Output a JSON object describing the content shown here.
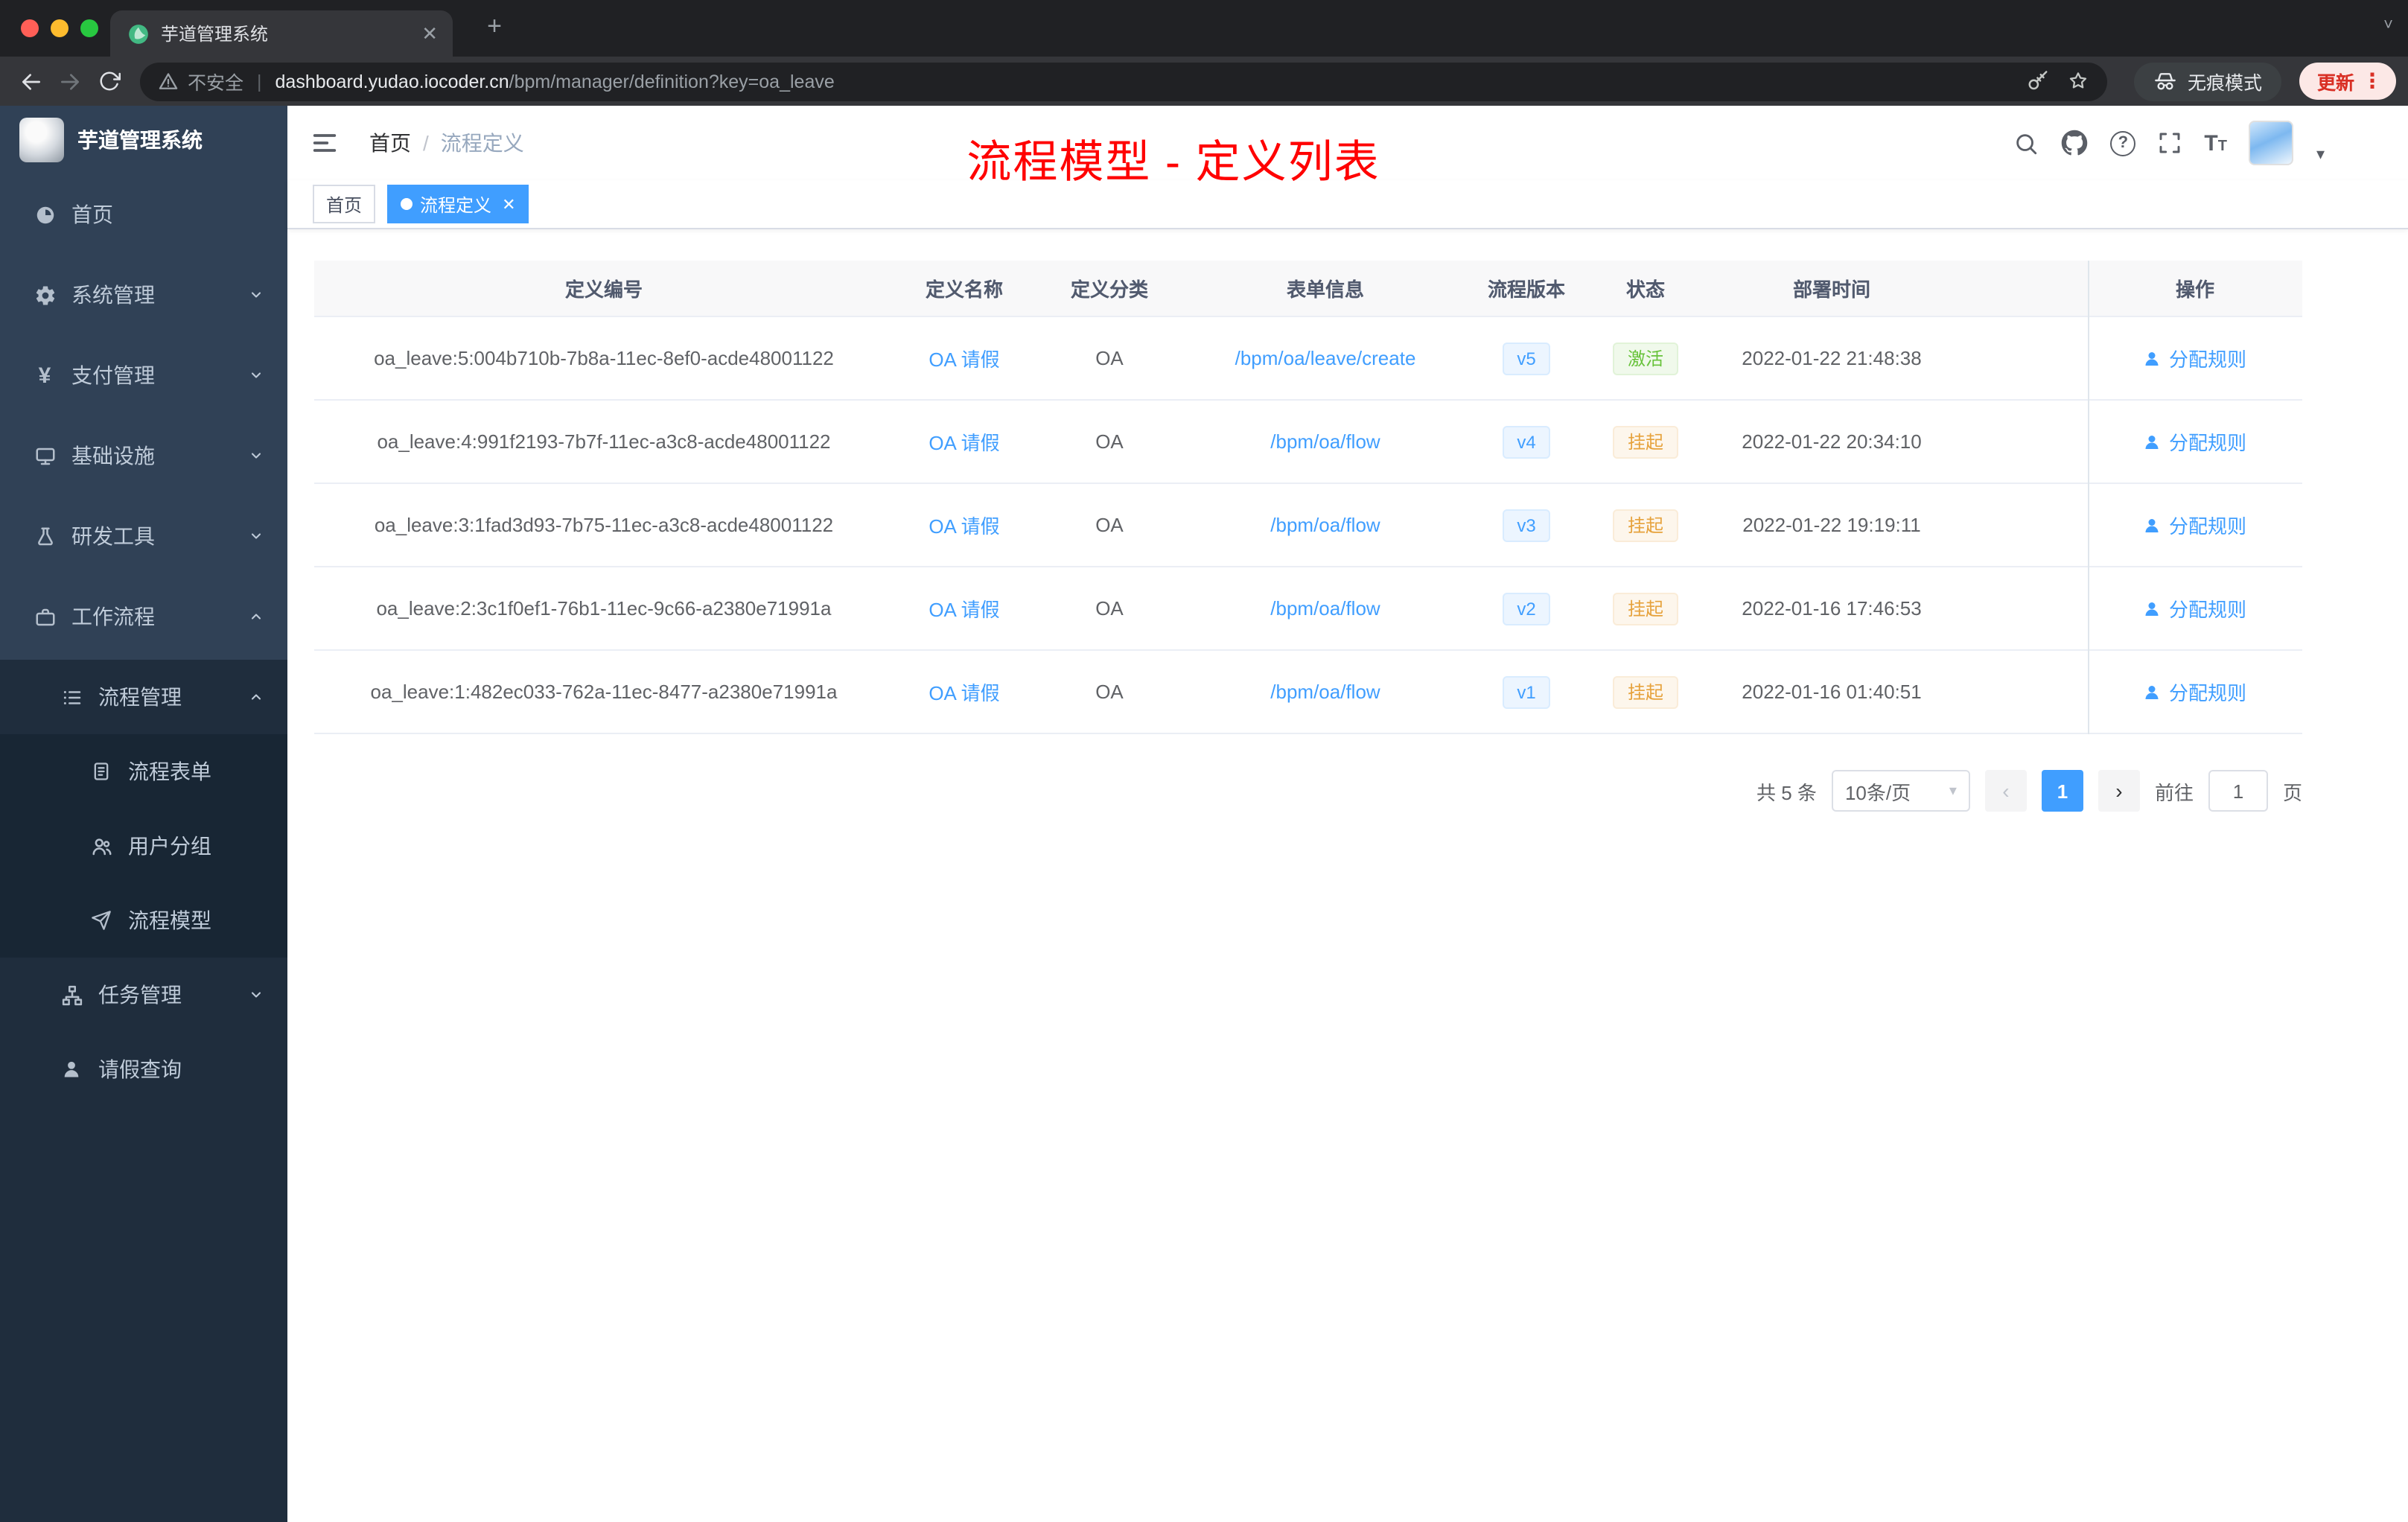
{
  "browser": {
    "tab_title": "芋道管理系统",
    "security_label": "不安全",
    "url_domain": "dashboard.yudao.iocoder.cn",
    "url_path": "/bpm/manager/definition?key=oa_leave",
    "incognito_label": "无痕模式",
    "update_label": "更新"
  },
  "sidebar": {
    "logo_title": "芋道管理系统",
    "items": [
      {
        "label": "首页"
      },
      {
        "label": "系统管理"
      },
      {
        "label": "支付管理"
      },
      {
        "label": "基础设施"
      },
      {
        "label": "研发工具"
      },
      {
        "label": "工作流程"
      },
      {
        "label": "流程管理"
      },
      {
        "label": "流程表单"
      },
      {
        "label": "用户分组"
      },
      {
        "label": "流程模型"
      },
      {
        "label": "任务管理"
      },
      {
        "label": "请假查询"
      }
    ]
  },
  "header": {
    "breadcrumb": {
      "home": "首页",
      "current": "流程定义"
    },
    "annotation": "流程模型 - 定义列表"
  },
  "tags": {
    "home": "首页",
    "active": "流程定义"
  },
  "table": {
    "columns": [
      "定义编号",
      "定义名称",
      "定义分类",
      "表单信息",
      "流程版本",
      "状态",
      "部署时间",
      "操作"
    ],
    "rows": [
      {
        "id": "oa_leave:5:004b710b-7b8a-11ec-8ef0-acde48001122",
        "name": "OA 请假",
        "category": "OA",
        "form": "/bpm/oa/leave/create",
        "version": "v5",
        "status": "激活",
        "time": "2022-01-22 21:48:38",
        "action": "分配规则"
      },
      {
        "id": "oa_leave:4:991f2193-7b7f-11ec-a3c8-acde48001122",
        "name": "OA 请假",
        "category": "OA",
        "form": "/bpm/oa/flow",
        "version": "v4",
        "status": "挂起",
        "time": "2022-01-22 20:34:10",
        "action": "分配规则"
      },
      {
        "id": "oa_leave:3:1fad3d93-7b75-11ec-a3c8-acde48001122",
        "name": "OA 请假",
        "category": "OA",
        "form": "/bpm/oa/flow",
        "version": "v3",
        "status": "挂起",
        "time": "2022-01-22 19:19:11",
        "action": "分配规则"
      },
      {
        "id": "oa_leave:2:3c1f0ef1-76b1-11ec-9c66-a2380e71991a",
        "name": "OA 请假",
        "category": "OA",
        "form": "/bpm/oa/flow",
        "version": "v2",
        "status": "挂起",
        "time": "2022-01-16 17:46:53",
        "action": "分配规则"
      },
      {
        "id": "oa_leave:1:482ec033-762a-11ec-8477-a2380e71991a",
        "name": "OA 请假",
        "category": "OA",
        "form": "/bpm/oa/flow",
        "version": "v1",
        "status": "挂起",
        "time": "2022-01-16 01:40:51",
        "action": "分配规则"
      }
    ]
  },
  "pagination": {
    "total": "共 5 条",
    "page_size": "10条/页",
    "current_page": "1",
    "goto_label": "前往",
    "goto_value": "1",
    "unit_label": "页"
  },
  "colors": {
    "primary": "#409eff",
    "success": "#67c23a",
    "warning": "#e6a23c",
    "annotation_red": "#ff0000",
    "sidebar_bg": "#304156",
    "submenu_bg": "#1f2d3d"
  }
}
